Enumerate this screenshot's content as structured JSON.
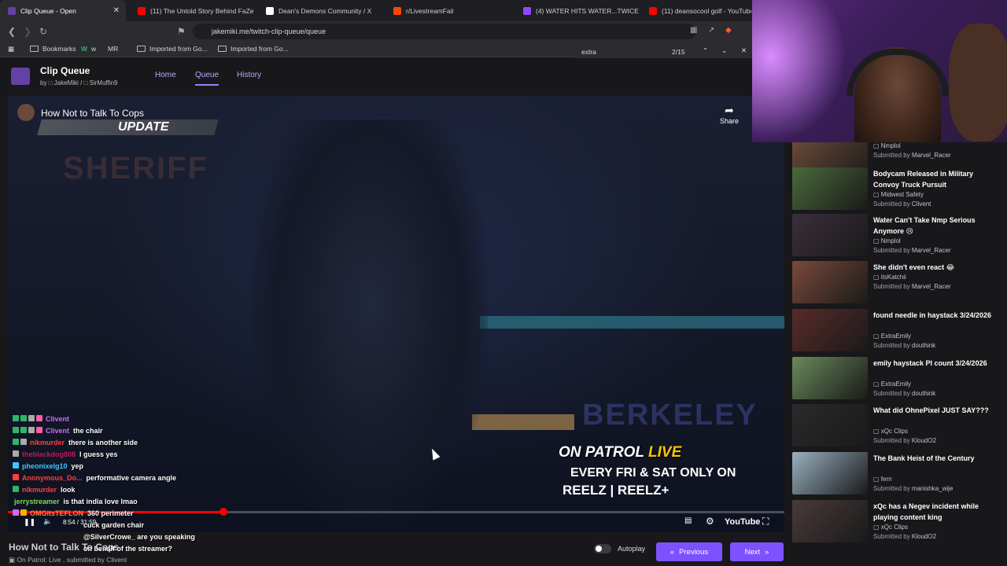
{
  "browser": {
    "tabs": [
      {
        "title": "Clip Queue - Open",
        "active": true,
        "color": "#6441a5"
      },
      {
        "title": "(11) The Untold Story Behind FaZe C",
        "active": false,
        "color": "#ff0000"
      },
      {
        "title": "Dean's Demons Community / X",
        "active": false,
        "color": "#ffffff"
      },
      {
        "title": "r/LivestreamFail",
        "active": false,
        "color": "#ff4500"
      },
      {
        "title": "(4) WATER HITS WATER...TWICE - Tw",
        "active": false,
        "color": "#9146ff"
      },
      {
        "title": "(11) deansocool golf - YouTube",
        "active": false,
        "color": "#ff0000"
      }
    ],
    "url": "jakemiki.me/twitch-clip-queue/queue",
    "bookmarks": {
      "bookmarks_label": "Bookmarks",
      "w_label": "w",
      "mr_label": "MR",
      "imported1": "Imported from Go...",
      "imported2": "Imported from Go..."
    },
    "find": {
      "query": "extra",
      "count": "2/15"
    }
  },
  "app": {
    "title": "Clip Queue",
    "by": "by",
    "author1": "JakeMiki",
    "separator": "/",
    "author2": "SirMuffin9",
    "nav": [
      "Home",
      "Queue",
      "History"
    ],
    "active_nav": "Queue"
  },
  "video": {
    "title": "How Not to Talk To Cops",
    "banner": "UPDATE",
    "share_label": "Share",
    "background_text_1": "SHERIFF",
    "background_text_2": "BERKELEY",
    "promo_line1_a": "ON PATROL",
    "promo_line1_b": "LIVE",
    "promo_line2": "EVERY FRI & SAT ONLY ON",
    "promo_line3": "REELZ | REELZ+",
    "time": "8:54 / 31:59",
    "progress_fraction": 0.278,
    "youtube_label": "YouTube",
    "bottom_title": "How Not to Talk To Cops",
    "meta": "On Patrol: Live , submitted by Clivent",
    "autoplay_label": "Autoplay",
    "prev_label": "Previous",
    "next_label": "Next"
  },
  "chat": [
    {
      "user": "Clivent",
      "color": "#c86bff",
      "msg": "",
      "badges": [
        "#2fb56a",
        "#2fb56a",
        "#aaa",
        "#ff5ea8"
      ]
    },
    {
      "user": "Clivent",
      "color": "#c86bff",
      "msg": "the chair",
      "badges": [
        "#2fb56a",
        "#2fb56a",
        "#aaa",
        "#ff5ea8"
      ]
    },
    {
      "user": "nikmurder",
      "color": "#ff4040",
      "msg": "there is another side",
      "badges": [
        "#2fb56a",
        "#aaa"
      ]
    },
    {
      "user": "theblackdog808",
      "color": "#c2185b",
      "msg": "I guess yes",
      "badges": [
        "#aaa"
      ]
    },
    {
      "user": "pheonixelg10",
      "color": "#3ec6ff",
      "msg": "yep",
      "badges": [
        "#3ec6ff"
      ]
    },
    {
      "user": "Anonymous_Do...",
      "color": "#ff3e3e",
      "msg": "performative camera angle",
      "badges": [
        "#ff3e3e"
      ]
    },
    {
      "user": "nikmurder",
      "color": "#ff4040",
      "msg": "look",
      "badges": [
        "#2fb56a"
      ]
    },
    {
      "user": "jerrystreamer",
      "color": "#7ed957",
      "msg": "is that india love lmao",
      "badges": []
    },
    {
      "user": "OMGitsTEFLON",
      "color": "#ff7f50",
      "msg": "360 perimeter",
      "badges": [
        "#c86bff",
        "#ffb000"
      ]
    },
    {
      "user": "",
      "color": "#ffffff",
      "msg": "cuck garden chair",
      "badges": []
    },
    {
      "user": "",
      "color": "#3a6bff",
      "msg": "@SilverCrowe_ are you speaking",
      "badges": []
    },
    {
      "user": "",
      "color": "#ffffff",
      "msg": "on behalf of the streamer?",
      "badges": []
    }
  ],
  "queue": [
    {
      "title": "",
      "channel": "Nmplol",
      "submitter": "Marvel_Racer",
      "thumb": "#6b4a3a",
      "partial": true
    },
    {
      "title": "Bodycam Released in Military Convoy Truck Pursuit",
      "channel": "Midwest Safety",
      "submitter": "Clivent",
      "thumb": "#4a6a3a"
    },
    {
      "title": "Water Can't Take Nmp Serious Anymore 😢",
      "channel": "Nmplol",
      "submitter": "Marvel_Racer",
      "thumb": "#3a2f3a"
    },
    {
      "title": "She didn't even react 😂",
      "channel": "itsKatchii",
      "submitter": "Marvel_Racer",
      "thumb": "#7a4a3a"
    },
    {
      "title": "found needle in haystack 3/24/2026",
      "channel": "ExtraEmily",
      "submitter": "douthink",
      "thumb": "#5a2a2a"
    },
    {
      "title": "emily haystack PI count 3/24/2026",
      "channel": "ExtraEmily",
      "submitter": "douthink",
      "thumb": "#6a8a5a"
    },
    {
      "title": "What did OhnePixel JUST SAY???",
      "channel": "xQc Clips",
      "submitter": "KloudO2",
      "thumb": "#2a2a2a"
    },
    {
      "title": "The Bank Heist of the Century",
      "channel": "fern",
      "submitter": "manishka_wije",
      "thumb": "#9ab0c0"
    },
    {
      "title": "xQc has a Negev incident while playing content king",
      "channel": "xQc Clips",
      "submitter": "KloudO2",
      "thumb": "#4a3a3a"
    }
  ],
  "queue_sub_prefix": "Submitted by",
  "colors": {
    "accent": "#7c52ff",
    "bg": "#18181b"
  }
}
